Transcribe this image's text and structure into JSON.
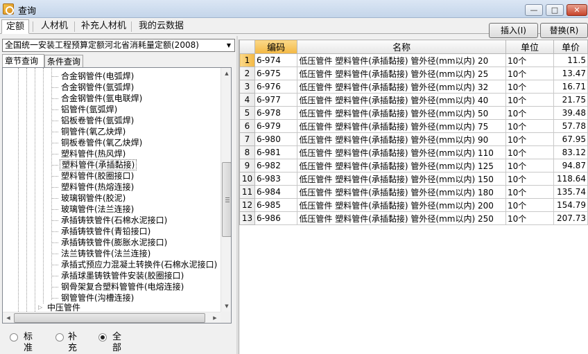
{
  "window": {
    "title": "查询",
    "minimize": "—",
    "maximize": "□",
    "close": "✕"
  },
  "tabs": [
    {
      "label": "定额",
      "active": true
    },
    {
      "label": "人材机",
      "active": false
    },
    {
      "label": "补充人材机",
      "active": false
    },
    {
      "label": "我的云数据",
      "active": false
    }
  ],
  "actions": {
    "insert": "插入(I)",
    "replace": "替换(R)"
  },
  "left": {
    "quota_library": "全国统一安装工程预算定额河北省消耗量定额(2008)",
    "subtabs": [
      "章节查询",
      "条件查询"
    ],
    "tree_items": [
      "合金钢管件(电弧焊)",
      "合金钢管件(氩弧焊)",
      "合金钢管件(氩电联焊)",
      "铝管件(氩弧焊)",
      "铝板卷管件(氩弧焊)",
      "铜管件(氧乙炔焊)",
      "铜板卷管件(氧乙炔焊)",
      "塑料管件(热风焊)",
      "塑料管件(承插黏接)",
      "塑料管件(胶圈接口)",
      "塑料管件(热熔连接)",
      "玻璃钢管件(胶泥)",
      "玻璃管件(法兰连接)",
      "承插铸铁管件(石棉水泥接口)",
      "承插铸铁管件(青铅接口)",
      "承插铸铁管件(膨胀水泥接口)",
      "法兰铸铁管件(法兰连接)",
      "承插式预应力混凝土转换件(石棉水泥接口)",
      "承插球墨铸铁管件安装(胶圈接口)",
      "钢骨架复合塑料管管件(电熔连接)",
      "钢管管件(沟槽连接)"
    ],
    "selected_index": 8,
    "parent_node": "中压管件",
    "radios": [
      {
        "label": "标准",
        "checked": false
      },
      {
        "label": "补充",
        "checked": false
      },
      {
        "label": "全部",
        "checked": true
      }
    ]
  },
  "grid": {
    "columns": [
      "",
      "编码",
      "名称",
      "单位",
      "单价"
    ],
    "rows": [
      {
        "n": "1",
        "code": "6-974",
        "name": "低压管件 塑料管件(承插黏接) 管外径(mm以内) 20",
        "unit": "10个",
        "price": "11.5"
      },
      {
        "n": "2",
        "code": "6-975",
        "name": "低压管件 塑料管件(承插黏接) 管外径(mm以内) 25",
        "unit": "10个",
        "price": "13.47"
      },
      {
        "n": "3",
        "code": "6-976",
        "name": "低压管件 塑料管件(承插黏接) 管外径(mm以内) 32",
        "unit": "10个",
        "price": "16.71"
      },
      {
        "n": "4",
        "code": "6-977",
        "name": "低压管件 塑料管件(承插黏接) 管外径(mm以内) 40",
        "unit": "10个",
        "price": "21.75"
      },
      {
        "n": "5",
        "code": "6-978",
        "name": "低压管件 塑料管件(承插黏接) 管外径(mm以内) 50",
        "unit": "10个",
        "price": "39.48"
      },
      {
        "n": "6",
        "code": "6-979",
        "name": "低压管件 塑料管件(承插黏接) 管外径(mm以内) 75",
        "unit": "10个",
        "price": "57.78"
      },
      {
        "n": "7",
        "code": "6-980",
        "name": "低压管件 塑料管件(承插黏接) 管外径(mm以内) 90",
        "unit": "10个",
        "price": "67.95"
      },
      {
        "n": "8",
        "code": "6-981",
        "name": "低压管件 塑料管件(承插黏接) 管外径(mm以内) 110",
        "unit": "10个",
        "price": "83.12"
      },
      {
        "n": "9",
        "code": "6-982",
        "name": "低压管件 塑料管件(承插黏接) 管外径(mm以内) 125",
        "unit": "10个",
        "price": "94.87"
      },
      {
        "n": "10",
        "code": "6-983",
        "name": "低压管件 塑料管件(承插黏接) 管外径(mm以内) 150",
        "unit": "10个",
        "price": "118.64"
      },
      {
        "n": "11",
        "code": "6-984",
        "name": "低压管件 塑料管件(承插黏接) 管外径(mm以内) 180",
        "unit": "10个",
        "price": "135.74"
      },
      {
        "n": "12",
        "code": "6-985",
        "name": "低压管件 塑料管件(承插黏接) 管外径(mm以内) 200",
        "unit": "10个",
        "price": "154.79"
      },
      {
        "n": "13",
        "code": "6-986",
        "name": "低压管件 塑料管件(承插黏接) 管外径(mm以内) 250",
        "unit": "10个",
        "price": "207.73"
      }
    ],
    "selected_row": 0
  }
}
